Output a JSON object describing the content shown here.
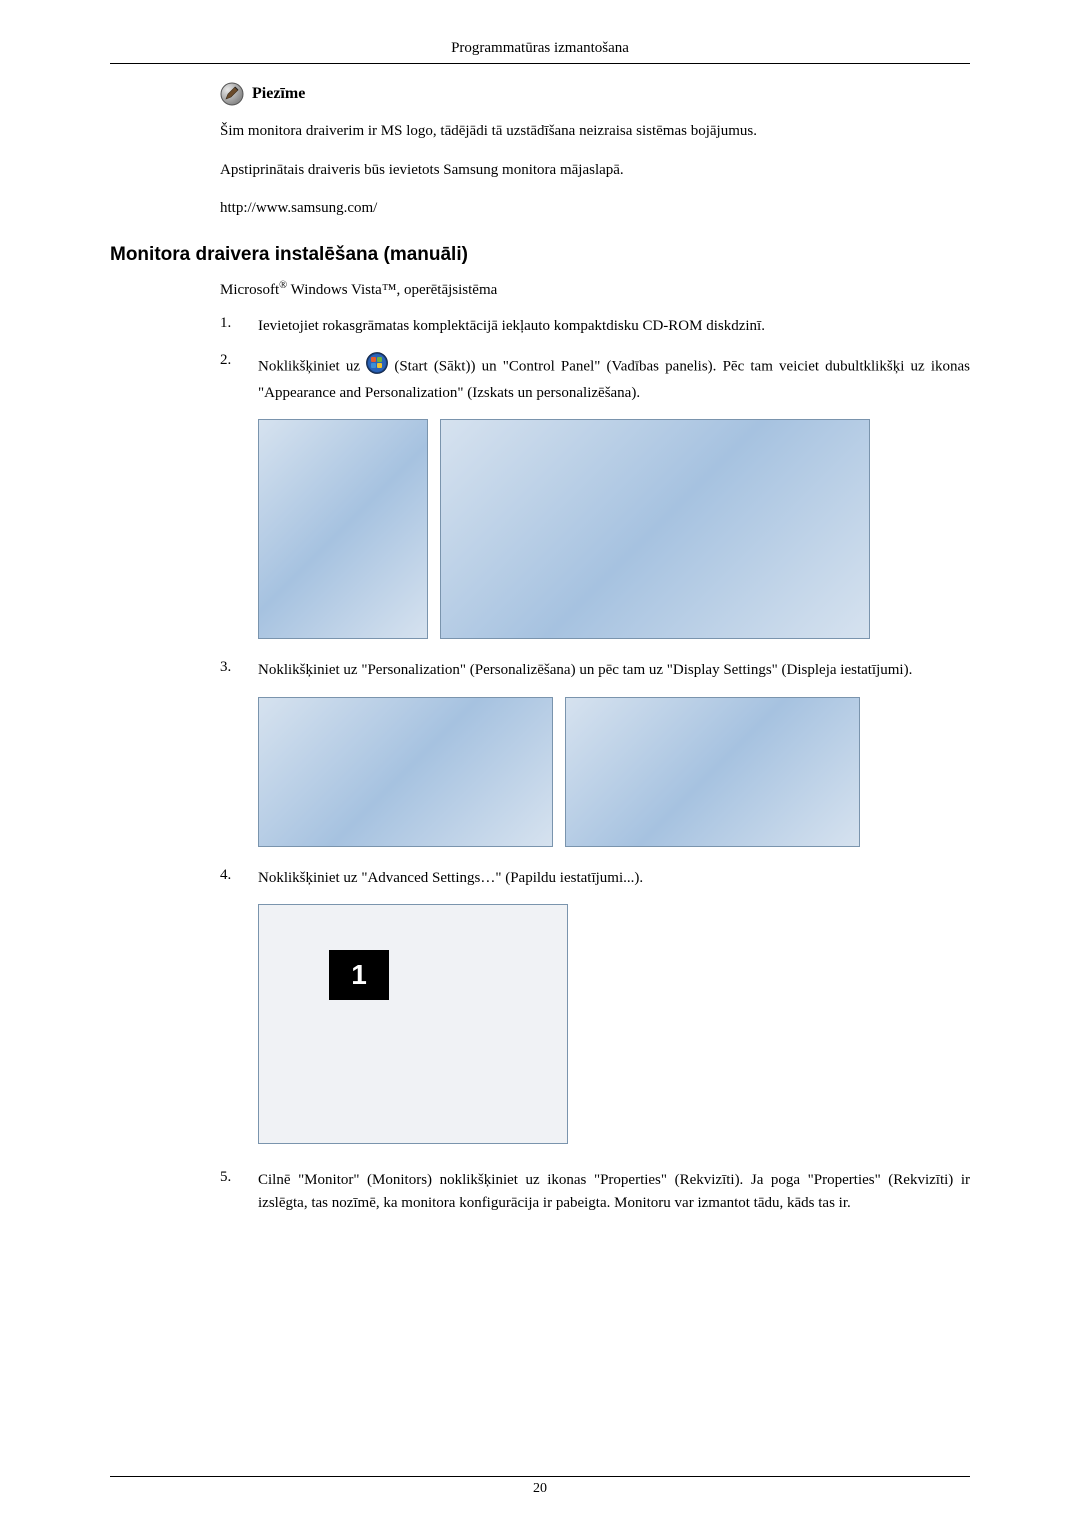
{
  "header": {
    "title": "Programmatūras izmantošana"
  },
  "note": {
    "icon": "pencil-icon",
    "label": "Piezīme",
    "lines": [
      "Šim monitora draiverim ir MS logo, tādējādi tā uzstādīšana neizraisa sistēmas bojājumus.",
      "Apstiprinātais draiveris būs ievietots Samsung monitora mājaslapā.",
      "http://www.samsung.com/"
    ]
  },
  "section": {
    "heading": "Monitora draivera instalēšana (manuāli)",
    "os_prefix": "Microsoft",
    "os_suffix": " Windows Vista™, operētājsistēma",
    "steps": [
      {
        "num": "1.",
        "text": "Ievietojiet rokasgrāmatas komplektācijā iekļauto kompaktdisku CD-ROM diskdzinī."
      },
      {
        "num": "2.",
        "text_before": "Noklikšķiniet uz ",
        "text_after": "(Start (Sākt)) un \"Control Panel\" (Vadības panelis). Pēc tam veiciet dubultklikšķi uz ikonas \"Appearance and Personalization\" (Izskats un personalizēšana).",
        "icon": "vista-start-orb"
      },
      {
        "num": "3.",
        "text": "Noklikšķiniet uz \"Personalization\" (Personalizēšana) un pēc tam uz \"Display Settings\" (Displeja iestatījumi)."
      },
      {
        "num": "4.",
        "text": "Noklikšķiniet uz \"Advanced Settings…\" (Papildu iestatījumi...)."
      },
      {
        "num": "5.",
        "text": "Cilnē \"Monitor\" (Monitors) noklikšķiniet uz ikonas \"Properties\" (Rekvizīti). Ja poga \"Properties\" (Rekvizīti) ir izslēgta, tas nozīmē, ka monitora konfigurācija ir pabeigta. Monitoru var izmantot tādu, kāds tas ir."
      }
    ]
  },
  "images": {
    "step2_a": "vista-start-menu-screenshot",
    "step2_b": "vista-control-panel-screenshot",
    "step3_a": "vista-appearance-personalization-screenshot",
    "step3_b": "vista-personalization-screenshot",
    "step4": "vista-display-settings-dialog"
  },
  "footer": {
    "page_number": "20"
  }
}
